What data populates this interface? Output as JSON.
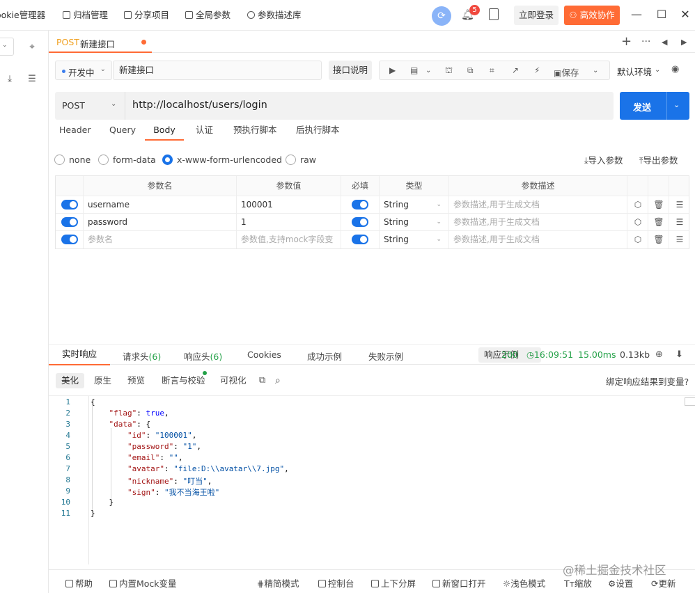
{
  "topbar": {
    "tabs": [
      "ookie管理器",
      "归档管理",
      "分享项目",
      "全局参数",
      "参数描述库"
    ],
    "notification_count": "5",
    "login_label": "立即登录",
    "collab_label": "高效协作"
  },
  "request_tab": {
    "method": "POST",
    "name": "新建接口"
  },
  "request": {
    "status": "开发中",
    "name": "新建接口",
    "doc_label": "接口说明",
    "save_label": "保存",
    "env_label": "默认环境",
    "method": "POST",
    "url": "http://localhost/users/login",
    "send_label": "发送"
  },
  "param_tabs": [
    "Header",
    "Query",
    "Body",
    "认证",
    "预执行脚本",
    "后执行脚本"
  ],
  "body_types": [
    "none",
    "form-data",
    "x-www-form-urlencoded",
    "raw"
  ],
  "import_label": "导入参数",
  "export_label": "导出参数",
  "table": {
    "headers": [
      "参数名",
      "参数值",
      "必填",
      "类型",
      "参数描述"
    ],
    "rows": [
      {
        "name": "username",
        "value": "100001",
        "type": "String",
        "desc": "参数描述,用于生成文档"
      },
      {
        "name": "password",
        "value": "1",
        "type": "String",
        "desc": "参数描述,用于生成文档"
      },
      {
        "name": "参数名",
        "value": "参数值,支持mock字段变",
        "type": "String",
        "desc": "参数描述,用于生成文档"
      }
    ]
  },
  "response": {
    "tabs": [
      "实时响应",
      "请求头",
      "响应头",
      "Cookies",
      "成功示例",
      "失败示例"
    ],
    "req_header_count": "(6)",
    "resp_header_count": "(6)",
    "example_label": "响应示例",
    "status_code": "200",
    "time": "16:09:51",
    "duration": "15.00ms",
    "size": "0.13kb",
    "sub_tabs": [
      "美化",
      "原生",
      "预览",
      "断言与校验",
      "可视化"
    ],
    "bind_label": "绑定响应结果到变量?",
    "lines": [
      "1",
      "2",
      "3",
      "4",
      "5",
      "6",
      "7",
      "8",
      "9",
      "10",
      "11"
    ],
    "json": {
      "flag": "true",
      "id": "\"100001\"",
      "password": "\"1\"",
      "email": "\"\"",
      "avatar": "\"file:D:\\\\avatar\\\\7.jpg\"",
      "nickname": "\"叮当\"",
      "sign": "\"我不当海王啦\""
    }
  },
  "bottombar": [
    "帮助",
    "内置Mock变量",
    "精简模式",
    "控制台",
    "上下分屏",
    "新窗口打开",
    "浅色模式",
    "缩放",
    "设置",
    "更新"
  ],
  "watermark": "@稀土掘金技术社区"
}
